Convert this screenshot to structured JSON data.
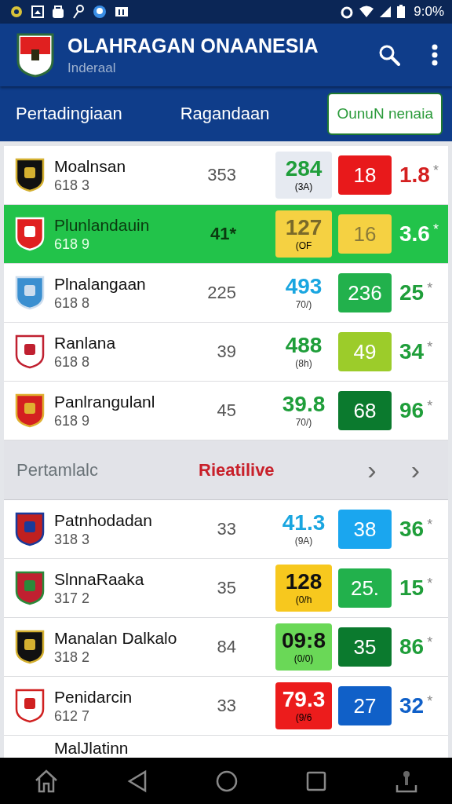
{
  "status_bar": {
    "battery": "9:0%"
  },
  "app_bar": {
    "title": "OLAHRAGAN ONAANESIA",
    "subtitle": "Inderaal"
  },
  "tabs": [
    {
      "label": "Pertadingiaan",
      "selected": false
    },
    {
      "label": "Ragandaan",
      "selected": false
    },
    {
      "label": "OunuN nenaia",
      "selected": true
    }
  ],
  "rows": [
    {
      "kind": "team",
      "selected": false,
      "name": "Moalnsan",
      "code": "618 3",
      "count": "353",
      "score": {
        "text": "284",
        "sub": "(3A)",
        "color": "#1f9e3a"
      },
      "tile": {
        "color": "#e6eaf1"
      },
      "box": {
        "text": "18",
        "color": "#e8191b"
      },
      "final": {
        "text": "1.8",
        "mark": "*",
        "color": "#d42020"
      }
    },
    {
      "kind": "team",
      "selected": true,
      "name": "Plunlandauin",
      "code": "618 9",
      "count": "41*",
      "score": {
        "text": "127",
        "sub": "(OF",
        "color": "#7a6a2a"
      },
      "tile": {
        "color": "#f5d142"
      },
      "box": {
        "text": "16",
        "color": "#f5d142"
      },
      "final": {
        "text": "3.6",
        "mark": "*",
        "color": "#ffffff"
      }
    },
    {
      "kind": "team",
      "selected": false,
      "name": "Plnalangaan",
      "code": "618 8",
      "count": "225",
      "score": {
        "text": "493",
        "sub": "70/)",
        "color": "#1aa6e0"
      },
      "box": {
        "text": "236",
        "color": "#22b14c"
      },
      "final": {
        "text": "25",
        "mark": "*",
        "color": "#1f9e3a"
      }
    },
    {
      "kind": "team",
      "selected": false,
      "name": "Ranlana",
      "code": "618 8",
      "count": "39",
      "score": {
        "text": "488",
        "sub": "(8h)",
        "color": "#1f9e3a"
      },
      "box": {
        "text": "49",
        "color": "#9ccc2a"
      },
      "final": {
        "text": "34",
        "mark": "*",
        "color": "#1f9e3a"
      }
    },
    {
      "kind": "team",
      "selected": false,
      "name": "Panlrangulanl",
      "code": "618 9",
      "count": "45",
      "score": {
        "text": "39.8",
        "sub": "70/)",
        "color": "#1f9e3a"
      },
      "box": {
        "text": "68",
        "color": "#0b7a2e"
      },
      "final": {
        "text": "96",
        "mark": "*",
        "color": "#1f9e3a"
      }
    },
    {
      "kind": "section",
      "label": "Pertamlalc",
      "status": "Rieatilive",
      "arrows": [
        "›",
        "›"
      ]
    },
    {
      "kind": "team",
      "selected": false,
      "name": "Patnhodadan",
      "code": "318 3",
      "count": "33",
      "score": {
        "text": "41.3",
        "sub": "(9A)",
        "color": "#1aa6e0"
      },
      "box": {
        "text": "38",
        "color": "#1aa6ef"
      },
      "final": {
        "text": "36",
        "mark": "*",
        "color": "#1f9e3a"
      }
    },
    {
      "kind": "team",
      "selected": false,
      "name": "SlnnaRaaka",
      "code": "317 2",
      "count": "35",
      "score": {
        "text": "128",
        "sub": "(0/h",
        "color": "#111111"
      },
      "tile": {
        "color": "#f7c81e"
      },
      "box": {
        "text": "25.",
        "color": "#22b14c"
      },
      "final": {
        "text": "15",
        "mark": "*",
        "color": "#1f9e3a"
      }
    },
    {
      "kind": "team",
      "selected": false,
      "name": "Manalan Dalkalo",
      "code": "318 2",
      "count": "84",
      "score": {
        "text": "09:8",
        "sub": "(0/0)",
        "color": "#111111"
      },
      "tile": {
        "color": "#6ad857"
      },
      "box": {
        "text": "35",
        "color": "#0b7a2e"
      },
      "final": {
        "text": "86",
        "mark": "*",
        "color": "#1f9e3a"
      }
    },
    {
      "kind": "team",
      "selected": false,
      "name": "Penidarcin",
      "code": "612 7",
      "count": "33",
      "score": {
        "text": "79.3",
        "sub": "(9/6",
        "color": "#ffffff"
      },
      "tile": {
        "color": "#ec1c1c"
      },
      "box": {
        "text": "27",
        "color": "#1060c8"
      },
      "final": {
        "text": "32",
        "mark": "*",
        "color": "#1060c8"
      }
    },
    {
      "kind": "partial",
      "name": "MalJlatinn"
    }
  ]
}
